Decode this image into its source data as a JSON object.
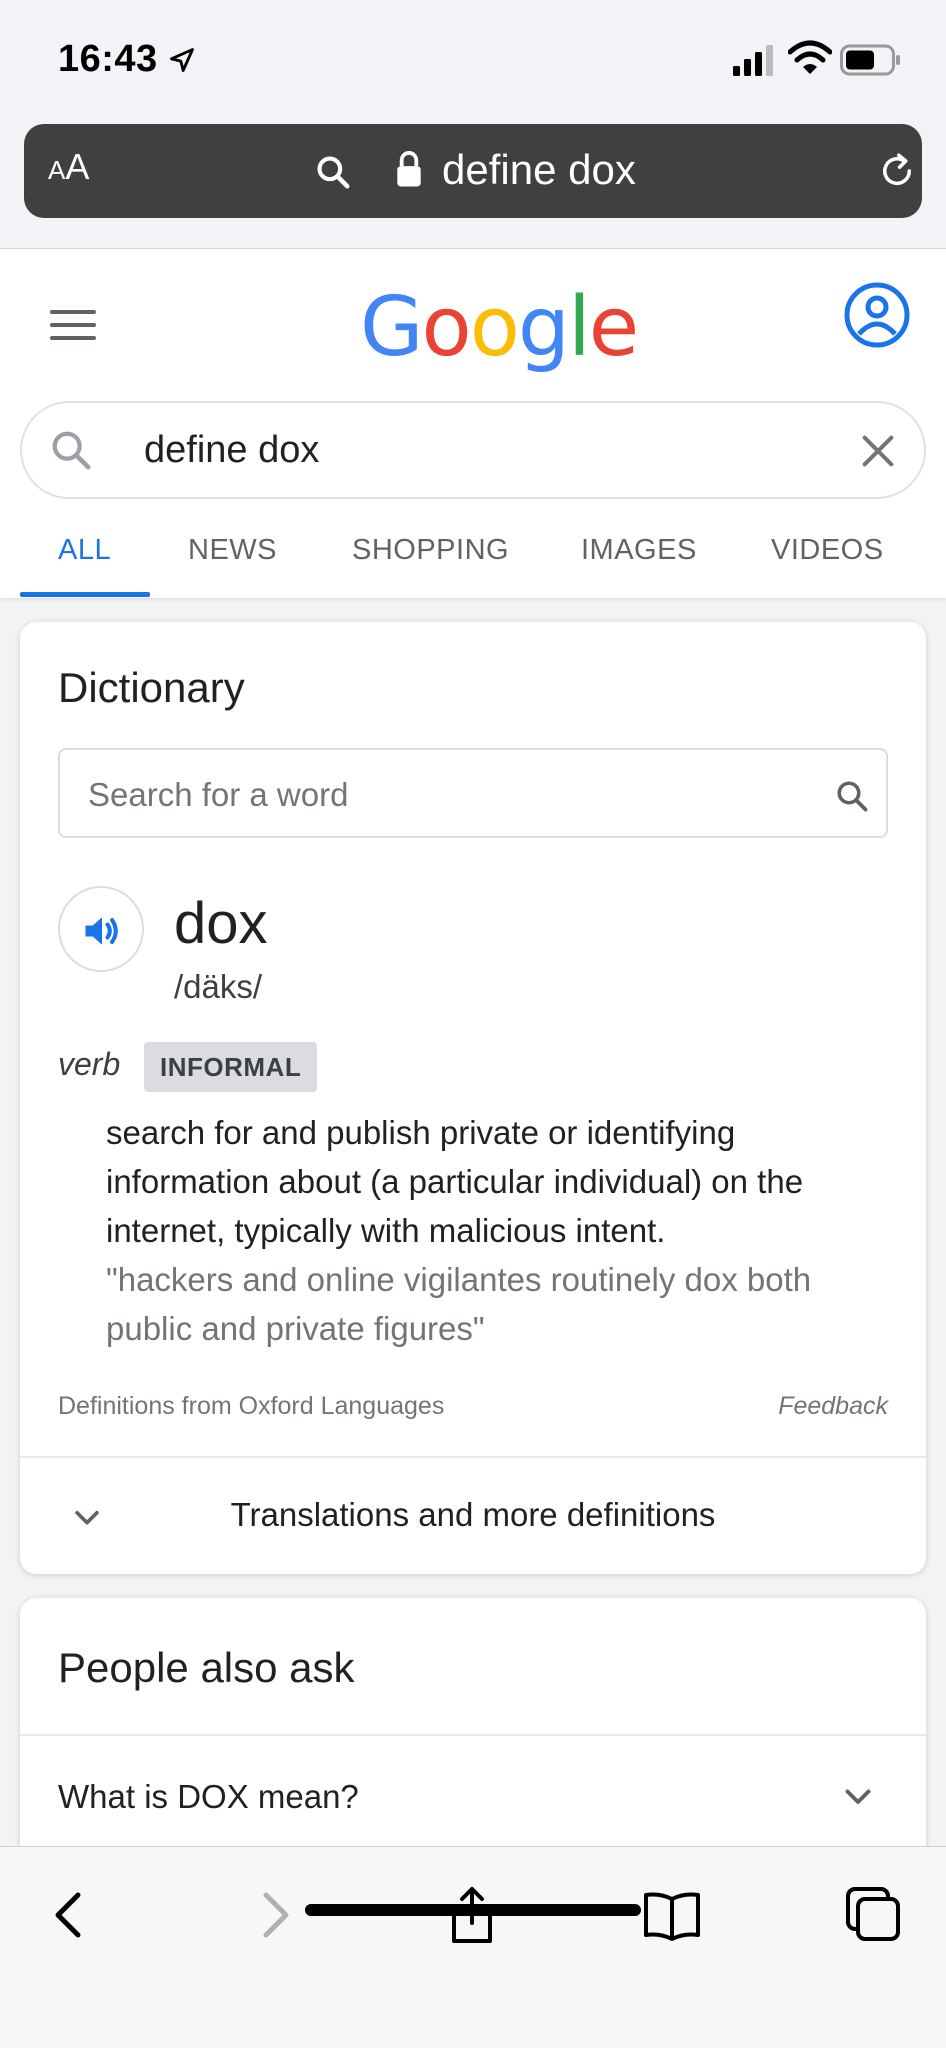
{
  "status_bar": {
    "time": "16:43"
  },
  "url_bar": {
    "aa_small": "A",
    "aa_large": "A",
    "url_text": "define dox"
  },
  "google": {
    "logo_letters": [
      {
        "char": "G",
        "color": "#4285F4"
      },
      {
        "char": "o",
        "color": "#EA4335"
      },
      {
        "char": "o",
        "color": "#FBBC05"
      },
      {
        "char": "g",
        "color": "#4285F4"
      },
      {
        "char": "l",
        "color": "#34A853"
      },
      {
        "char": "e",
        "color": "#EA4335"
      }
    ]
  },
  "search": {
    "query": "define dox"
  },
  "tabs": [
    {
      "label": "ALL",
      "active": true
    },
    {
      "label": "NEWS",
      "active": false
    },
    {
      "label": "SHOPPING",
      "active": false
    },
    {
      "label": "IMAGES",
      "active": false
    },
    {
      "label": "VIDEOS",
      "active": false
    }
  ],
  "dictionary": {
    "title": "Dictionary",
    "search_placeholder": "Search for a word",
    "word": "dox",
    "phonetic": "/däks/",
    "part_of_speech": "verb",
    "label": "INFORMAL",
    "definition": "search for and publish private or identifying information about (a particular individual) on the internet, typically with malicious intent.",
    "example": "\"hackers and online vigilantes routinely dox both public and private figures\"",
    "source": "Definitions from Oxford Languages",
    "feedback": "Feedback",
    "more_label": "Translations and more definitions"
  },
  "people_also_ask": {
    "title": "People also ask",
    "questions": [
      "What is DOX mean?"
    ]
  },
  "colors": {
    "accent": "#1a73e8",
    "url_bar_bg": "#404040"
  }
}
